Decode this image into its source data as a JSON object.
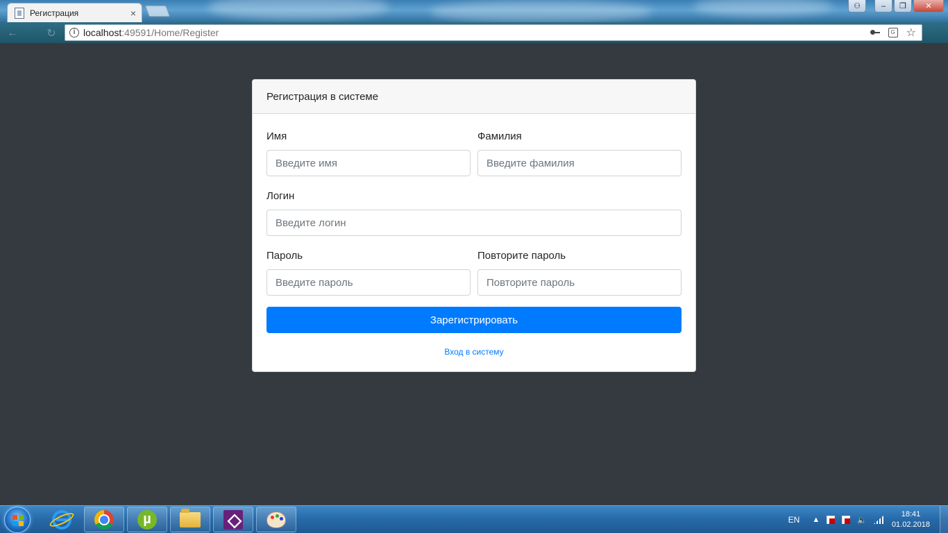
{
  "browser": {
    "tab_title": "Регистрация",
    "tab_close": "×",
    "url_host": "localhost",
    "url_rest": ":49591/Home/Register",
    "info_glyph": "i",
    "translate_glyph": "G",
    "star_glyph": "☆",
    "window_buttons": {
      "minimize": "–",
      "restore": "❐",
      "close": "✕",
      "user": "⚇"
    }
  },
  "form": {
    "header": "Регистрация в системе",
    "first_name": {
      "label": "Имя",
      "placeholder": "Введите имя"
    },
    "last_name": {
      "label": "Фамилия",
      "placeholder": "Введите фамилия"
    },
    "login": {
      "label": "Логин",
      "placeholder": "Введите логин"
    },
    "password": {
      "label": "Пароль",
      "placeholder": "Введите пароль"
    },
    "password_repeat": {
      "label": "Повторите пароль",
      "placeholder": "Повторите пароль"
    },
    "submit_label": "Зарегистрировать",
    "login_link": "Вход в систему"
  },
  "taskbar": {
    "apps": [
      "internet-explorer",
      "chrome",
      "utorrent",
      "file-explorer",
      "visual-studio",
      "paint"
    ],
    "utorrent_glyph": "µ",
    "language": "EN",
    "tray_arrow": "▲",
    "volume_glyph": "🔈",
    "time": "18:41",
    "date": "01.02.2018"
  },
  "colors": {
    "page_background": "#343a40",
    "primary": "#007bff",
    "card_header": "#f7f7f7"
  }
}
